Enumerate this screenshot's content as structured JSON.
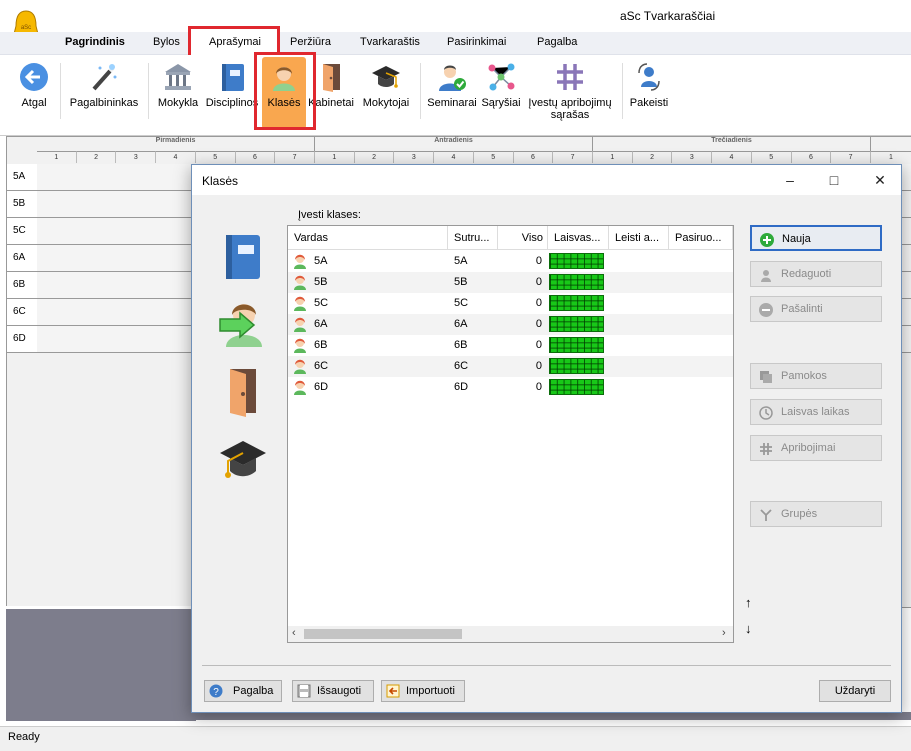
{
  "app": {
    "title": "aSc Tvarkaraščiai"
  },
  "menu": {
    "tabs": [
      {
        "label": "Pagrindinis"
      },
      {
        "label": "Bylos"
      },
      {
        "label": "Aprašymai"
      },
      {
        "label": "Peržiūra"
      },
      {
        "label": "Tvarkaraštis"
      },
      {
        "label": "Pasirinkimai"
      },
      {
        "label": "Pagalba"
      }
    ]
  },
  "ribbon": {
    "buttons": [
      {
        "label": "Atgal",
        "icon": "back-arrow-icon"
      },
      {
        "label": "Pagalbininkas",
        "icon": "magic-wand-icon"
      },
      {
        "label": "Mokykla",
        "icon": "school-building-icon"
      },
      {
        "label": "Disciplinos",
        "icon": "book-icon"
      },
      {
        "label": "Klasės",
        "icon": "class-student-icon"
      },
      {
        "label": "Kabinetai",
        "icon": "door-icon"
      },
      {
        "label": "Mokytojai",
        "icon": "graduation-cap-icon"
      },
      {
        "label": "Seminarai",
        "icon": "teacher-check-icon"
      },
      {
        "label": "Sąryšiai",
        "icon": "network-icon"
      },
      {
        "label": "Įvestų apribojimų sąrašas",
        "icon": "hash-grid-icon"
      },
      {
        "label": "Pakeisti",
        "icon": "swap-person-icon"
      }
    ]
  },
  "timetable": {
    "days": [
      "Pirmadienis",
      "Antradienis",
      "Trečiadienis"
    ],
    "periods": [
      "1",
      "2",
      "3",
      "4",
      "5",
      "6",
      "7"
    ],
    "extra_period": "1",
    "rows": [
      "5A",
      "5B",
      "5C",
      "6A",
      "6B",
      "6C",
      "6D"
    ]
  },
  "dialog": {
    "title": "Klasės",
    "list_label": "Įvesti klases:",
    "columns": [
      "Vardas",
      "Sutru...",
      "Viso",
      "Laisvas...",
      "Leisti a...",
      "Pasiruo..."
    ],
    "rows": [
      {
        "name": "5A",
        "short": "5A",
        "total": "0"
      },
      {
        "name": "5B",
        "short": "5B",
        "total": "0"
      },
      {
        "name": "5C",
        "short": "5C",
        "total": "0"
      },
      {
        "name": "6A",
        "short": "6A",
        "total": "0"
      },
      {
        "name": "6B",
        "short": "6B",
        "total": "0"
      },
      {
        "name": "6C",
        "short": "6C",
        "total": "0"
      },
      {
        "name": "6D",
        "short": "6D",
        "total": "0"
      }
    ],
    "actions": {
      "new": "Nauja",
      "edit": "Redaguoti",
      "delete": "Pašalinti",
      "lessons": "Pamokos",
      "free_time": "Laisvas laikas",
      "constraints": "Apribojimai",
      "groups": "Grupės"
    },
    "footer": {
      "help": "Pagalba",
      "save": "Išsaugoti",
      "import": "Importuoti",
      "close": "Uždaryti"
    }
  },
  "status": {
    "text": "Ready"
  },
  "colors": {
    "accent": "#2f6bc5",
    "highlight": "#e0282f",
    "active_tab": "#f9a74f",
    "availability": "#18c818"
  }
}
